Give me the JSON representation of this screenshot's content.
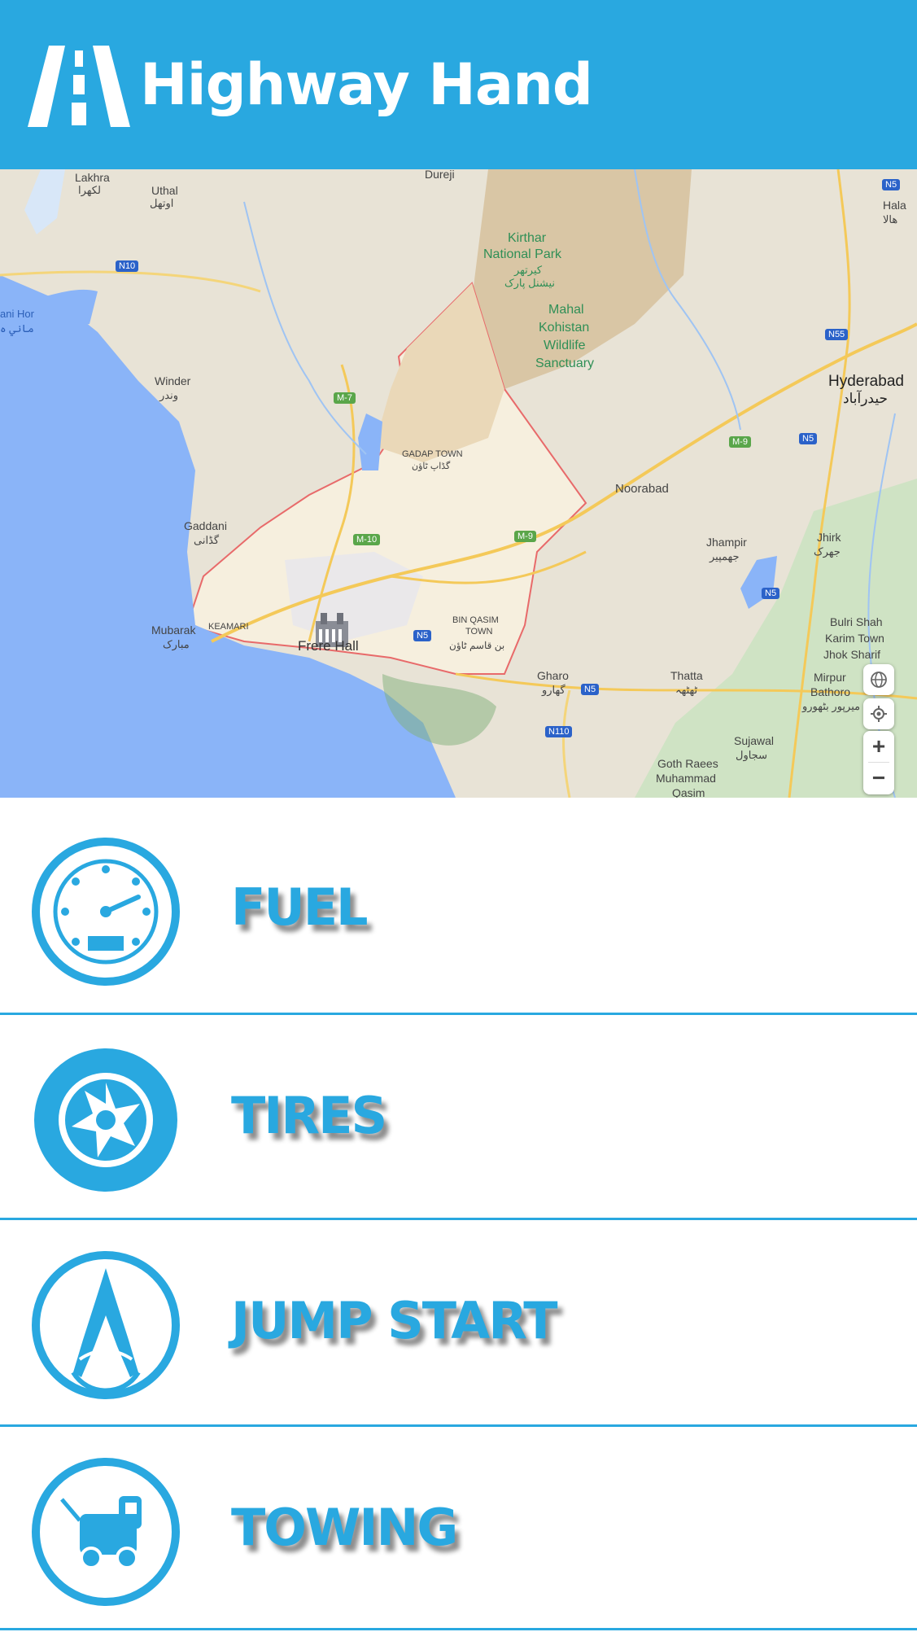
{
  "app": {
    "title": "Highway Hand"
  },
  "map": {
    "labels": {
      "lakhra": "Lakhra",
      "lakhra_ur": "لکھرا",
      "uthal": "Uthal",
      "uthal_ur": "اوتھل",
      "dureji": "Dureji",
      "hala": "Hala",
      "hala_ur": "ھالا",
      "kirthar": "Kirthar",
      "national_park": "National Park",
      "kirthar_ur1": "کیرتھر",
      "kirthar_ur2": "نیشنل پارک",
      "mahal": "Mahal",
      "kohistan": "Kohistan",
      "wildlife": "Wildlife",
      "sanctuary": "Sanctuary",
      "hor": "ani Hor",
      "hor_ur": "ماني ہ",
      "winder": "Winder",
      "winder_ur": "وندر",
      "hyderabad": "Hyderabad",
      "hyderabad_ur": "حیدرآباد",
      "gadap": "GADAP TOWN",
      "gadap_ur": "گڈاپ ٹاؤن",
      "noorabad": "Noorabad",
      "gaddani": "Gaddani",
      "gaddani_ur": "گڈانی",
      "jhampir": "Jhampir",
      "jhampir_ur": "جھمپیر",
      "jhirk": "Jhirk",
      "jhirk_ur": "جھرک",
      "mubarak": "Mubarak",
      "mubarak_ur": "مبارک",
      "keamari": "KEAMARI",
      "frere": "Frere Hall",
      "binqasim": "BIN QASIM",
      "town": "TOWN",
      "binqasim_ur": "بن قاسم ٹاؤن",
      "bulri": "Bulri Shah",
      "karim": "Karim Town",
      "jhok": "Jhok Sharif",
      "gharo": "Gharo",
      "gharo_ur": "گھارو",
      "thatta": "Thatta",
      "thatta_ur": "ٹھٹھہ",
      "mirpur": "Mirpur",
      "bathoro": "Bathoro",
      "mirpur_ur": "میرپور بٹھورو",
      "sujawal": "Sujawal",
      "sujawal_ur": "سجاول",
      "goth": "Goth Raees",
      "muhammad": "Muhammad",
      "qasim": "Qasim"
    },
    "shields": {
      "n5_top": "N5",
      "n10": "N10",
      "n55": "N55",
      "m7": "M-7",
      "m9_a": "M-9",
      "n5_b": "N5",
      "m10": "M-10",
      "m9_b": "M-9",
      "n5_c": "N5",
      "n5_d": "N5",
      "n5_e": "N5",
      "n110": "N110"
    },
    "controls": {
      "globe": "globe-icon",
      "locate": "locate-icon",
      "zoom_in": "+",
      "zoom_out": "−"
    }
  },
  "services": [
    {
      "label": "FUEL",
      "icon": "speedometer-icon"
    },
    {
      "label": "TIRES",
      "icon": "tire-icon"
    },
    {
      "label": "JUMP START",
      "icon": "jumper-cables-icon"
    },
    {
      "label": "TOWING",
      "icon": "tow-truck-icon"
    }
  ],
  "colors": {
    "brand": "#29a8e0",
    "sea": "#8ab4f8",
    "park": "#d4c2a3",
    "region": "#f5ecd9"
  }
}
